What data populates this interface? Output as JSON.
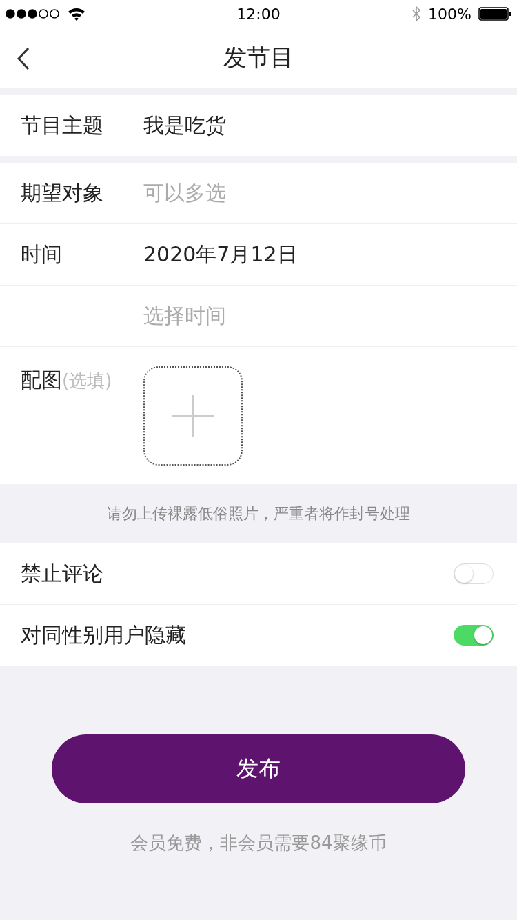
{
  "status_bar": {
    "time": "12:00",
    "battery": "100%"
  },
  "nav": {
    "title": "发节目"
  },
  "groups": [
    [
      {
        "label": "节目主题",
        "value": "我是吃货"
      }
    ],
    [
      {
        "label": "期望对象",
        "placeholder": "可以多选"
      },
      {
        "label": "时间",
        "value": "2020年7月12日"
      },
      {
        "placeholder": "选择时间"
      }
    ]
  ],
  "photo": {
    "label": "配图",
    "hint": "(选填)"
  },
  "notice": "请勿上传裸露低俗照片，严重者将作封号处理",
  "toggles": [
    {
      "label": "禁止评论",
      "on": false
    },
    {
      "label": "对同性别用户隐藏",
      "on": true
    }
  ],
  "submit": "发布",
  "footnote": "会员免费，非会员需要84聚缘币"
}
